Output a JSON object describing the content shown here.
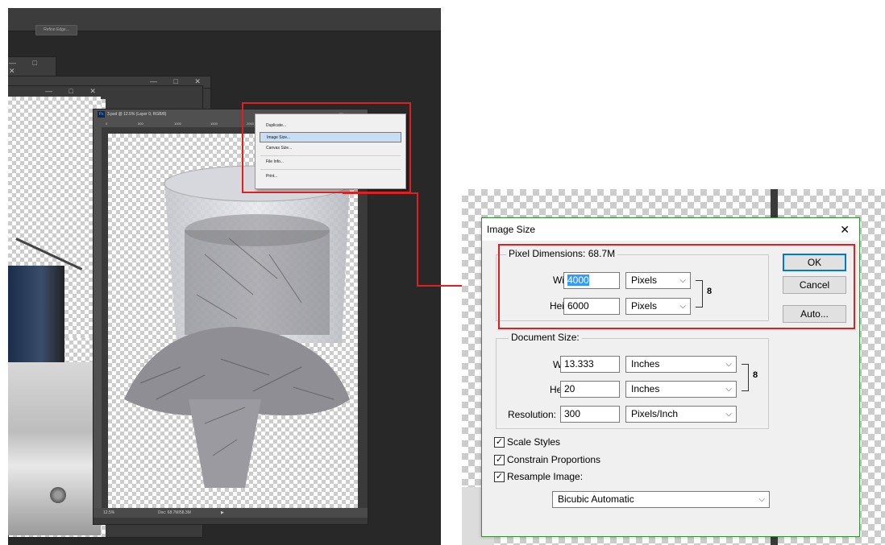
{
  "photoshop": {
    "options_bar": {
      "refine_edge_button": "Refine Edge..."
    },
    "document": {
      "title": "3.psd @ 12.5% (Layer 0, RGB/8)",
      "ruler_ticks": [
        "0",
        "500",
        "1000",
        "1500",
        "2000"
      ],
      "zoom": "12.5%",
      "doc_info": "Doc: 68.7M/58.3M"
    },
    "context_menu": {
      "items": [
        "Duplicate...",
        "Image Size...",
        "Canvas Size...",
        "File Info...",
        "Print..."
      ],
      "selected": "Image Size..."
    },
    "window_buttons": "— □ ✕"
  },
  "dialog": {
    "title": "Image Size",
    "close": "✕",
    "pixel_dimensions": {
      "label": "Pixel Dimensions:",
      "size": "68.7M",
      "width_label": "Width:",
      "width_value": "4000",
      "width_unit": "Pixels",
      "height_label": "Height:",
      "height_value": "6000",
      "height_unit": "Pixels"
    },
    "document_size": {
      "label": "Document Size:",
      "width_label": "Width:",
      "width_value": "13.333",
      "width_unit": "Inches",
      "height_label": "Height:",
      "height_value": "20",
      "height_unit": "Inches",
      "resolution_label": "Resolution:",
      "resolution_value": "300",
      "resolution_unit": "Pixels/Inch"
    },
    "buttons": {
      "ok": "OK",
      "cancel": "Cancel",
      "auto": "Auto..."
    },
    "checkboxes": [
      {
        "label": "Scale Styles",
        "checked": true
      },
      {
        "label": "Constrain Proportions",
        "checked": true
      },
      {
        "label": "Resample Image:",
        "checked": true
      }
    ],
    "resample_method": "Bicubic Automatic",
    "check_mark": "✓",
    "chevron": "⌵",
    "link_icon": "8"
  },
  "colors": {
    "highlight_red": "#e02020",
    "dialog_border": "#3c8f3c",
    "menu_selected": "#c8def5"
  }
}
